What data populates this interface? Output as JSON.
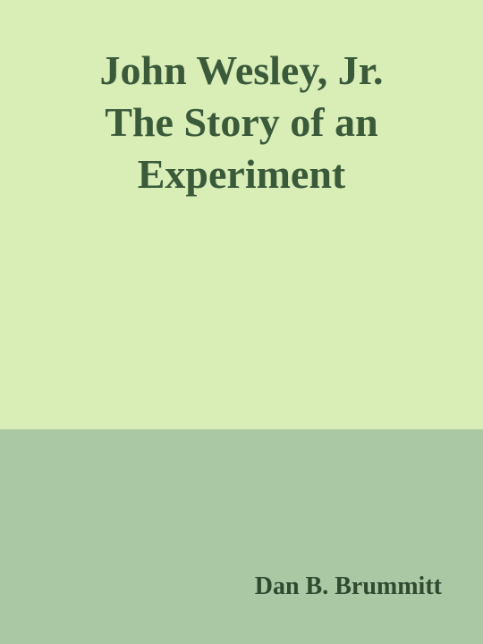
{
  "cover": {
    "title_lines": [
      "John Wesley, Jr.",
      "The Story of an",
      "Experiment"
    ],
    "author": "Dan B. Brummitt"
  },
  "colors": {
    "top_background": "#d9edb7",
    "bottom_background": "#abc8a4",
    "title_text": "#3a5a3a",
    "author_text": "#2f4a2f"
  }
}
